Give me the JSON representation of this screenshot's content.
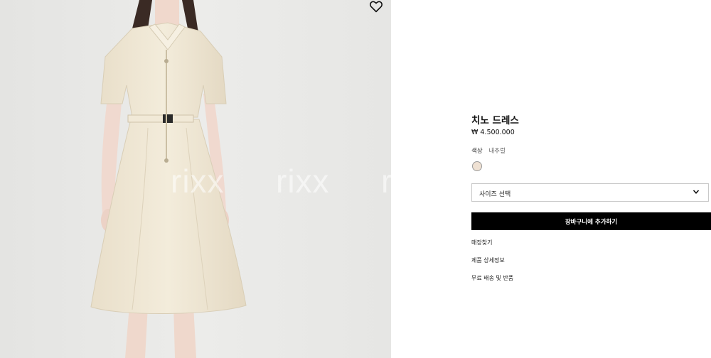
{
  "product": {
    "title": "치노 드레스",
    "price": "₩ 4.500.000",
    "color_label": "색상",
    "color_value": "내추럴",
    "swatch_color": "#efe1d3",
    "size_placeholder": "사이즈 선택",
    "add_to_cart": "장바구니에 추가하기"
  },
  "links": [
    "매장찾기",
    "제품 상세정보",
    "무료 배송 및 반품"
  ],
  "watermark": [
    "rixx",
    "rixx",
    "ri"
  ],
  "icons": {
    "wishlist": "heart-outline-icon",
    "dropdown": "chevron-down-icon"
  }
}
